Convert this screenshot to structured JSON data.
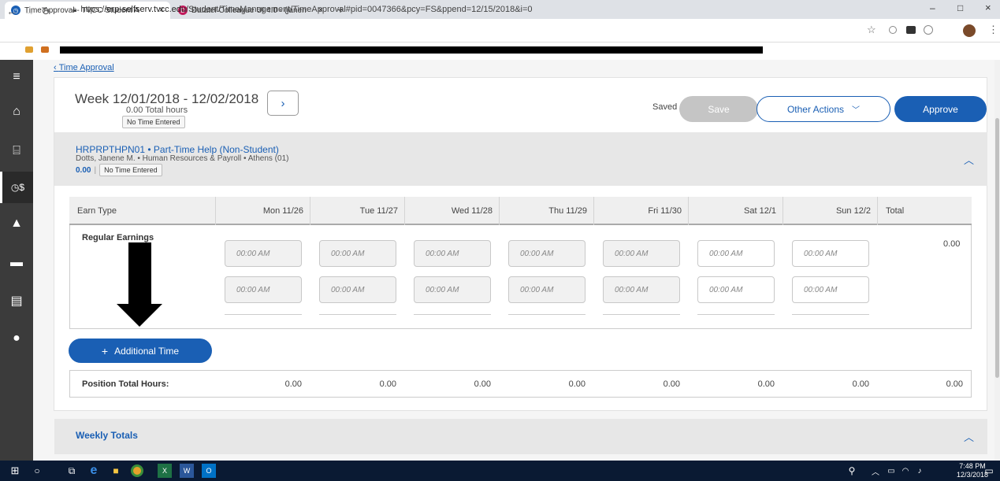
{
  "browser": {
    "tabs": [
      {
        "title": "Time Approval - TVCC Student A",
        "close": "×"
      },
      {
        "title": "Datatel Colleague UI 4.0 - (janen",
        "close": "×"
      }
    ],
    "new_tab": "+",
    "url_prefix": "https://",
    "url_host": "erp-selfserv.tvcc.edu",
    "url_path": "/Student/TimeManagement/TimeApproval#pid=0047366&pcy=FS&ppend=12/15/2018&i=0",
    "window_controls": [
      "–",
      "□",
      "×"
    ]
  },
  "page": {
    "back_link": "Time Approval",
    "week_title": "Week 12/01/2018 - 12/02/2018",
    "total_hours": "0.00 Total hours",
    "status_badge": "No Time Entered",
    "saved_label": "Saved",
    "save_button": "Save",
    "other_actions_button": "Other Actions",
    "approve_button": "Approve",
    "position": {
      "title": "HRPRPTHPN01 • Part-Time Help (Non-Student)",
      "subtitle": "Dotts, Janene M. • Human Resources & Payroll • Athens (01)",
      "hours": "0.00",
      "status": "No Time Entered"
    },
    "grid": {
      "headers": [
        "Earn Type",
        "Mon 11/26",
        "Tue 11/27",
        "Wed 11/28",
        "Thu 11/29",
        "Fri 11/30",
        "Sat 12/1",
        "Sun 12/2",
        "Total"
      ],
      "earn_type": "Regular Earnings",
      "placeholder": "00:00 AM",
      "row_total": "0.00"
    },
    "additional_time_button": "Additional Time",
    "position_total_label": "Position Total Hours:",
    "position_totals": [
      "0.00",
      "0.00",
      "0.00",
      "0.00",
      "0.00",
      "0.00",
      "0.00",
      "0.00"
    ],
    "weekly_totals": "Weekly Totals"
  },
  "taskbar": {
    "time": "7:48 PM",
    "date": "12/3/2018"
  },
  "colors": {
    "accent": "#1a5fb4",
    "sidebar": "#3b3b3b",
    "taskbar": "#0a1a33"
  }
}
